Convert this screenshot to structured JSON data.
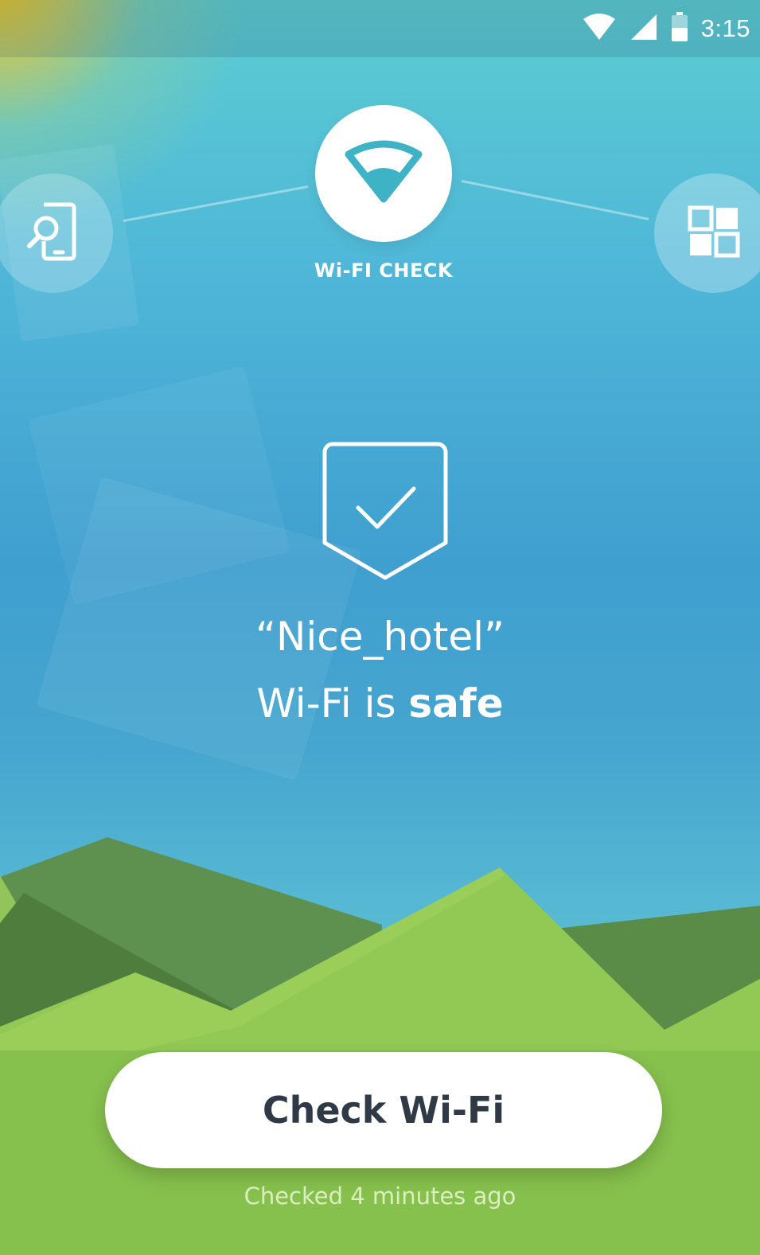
{
  "status_bar": {
    "time": "3:15",
    "icons": [
      "wifi-signal-icon",
      "cellular-signal-icon",
      "battery-icon"
    ]
  },
  "nav": {
    "left_icon": "phone-search-icon",
    "center_icon": "wifi-icon",
    "center_label": "Wi-FI CHECK",
    "right_icon": "apps-grid-icon"
  },
  "result": {
    "icon": "shield-check-icon",
    "network_name": "“Nice_hotel”",
    "line2_prefix": "Wi-Fi is",
    "line2_status": "safe"
  },
  "action": {
    "button_label": "Check Wi-Fi",
    "last_checked": "Checked 4 minutes ago"
  },
  "colors": {
    "sky_top": "#5ccdd2",
    "sky_mid": "#3f9fcf",
    "sun": "#f6c418",
    "hill_light": "#8cc84b",
    "hill_dark": "#5a8a45",
    "button_text": "#2f3a46"
  }
}
